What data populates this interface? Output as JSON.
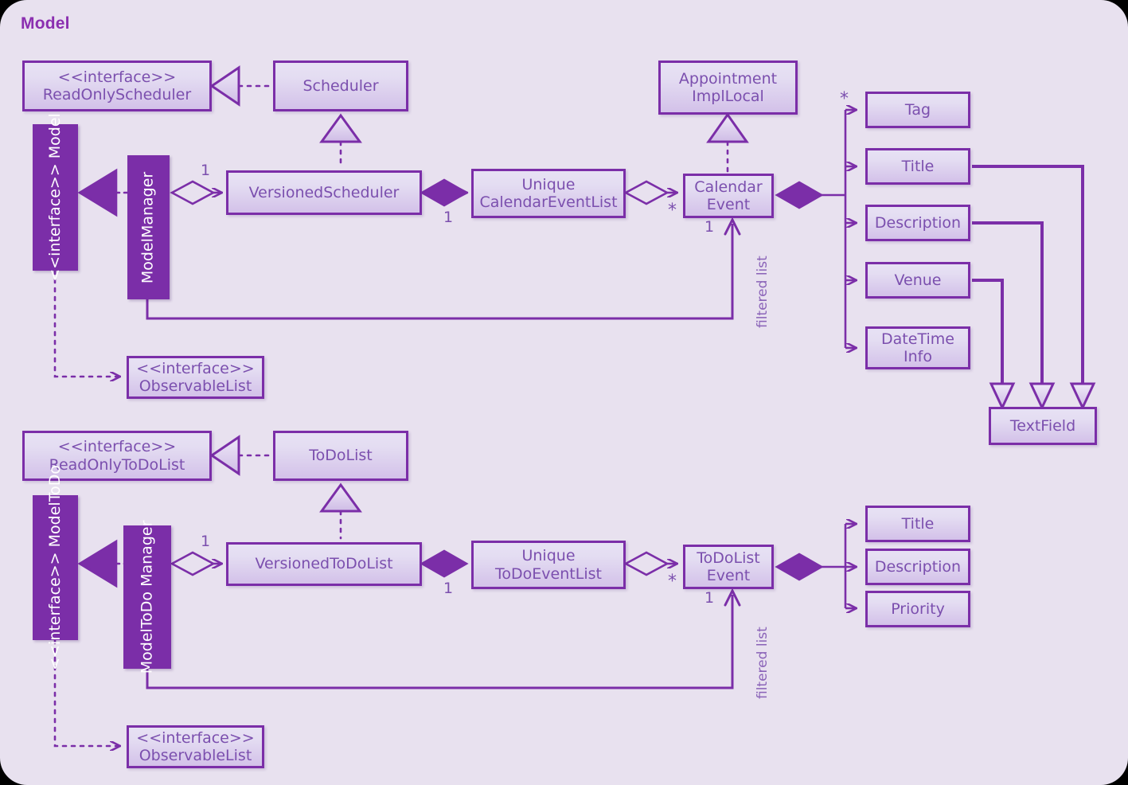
{
  "diagram": {
    "title": "Model",
    "type": "uml-class-diagram",
    "accent_color": "#7b2ea8",
    "text_color": "#7b4fae",
    "background_color": "#e8e1ef",
    "box_fill_top": "#e7e1f4",
    "box_fill_bottom": "#d3c1e9"
  },
  "classes": {
    "read_only_scheduler": {
      "stereotype": "<<interface>>",
      "name": "ReadOnlyScheduler"
    },
    "scheduler": {
      "name": "Scheduler"
    },
    "model": {
      "stereotype": "<<interface>>",
      "name": "Model"
    },
    "model_manager": {
      "name": "ModelManager"
    },
    "versioned_scheduler": {
      "name": "VersionedScheduler"
    },
    "unique_calendar_event_list": {
      "line1": "Unique",
      "line2": "CalendarEventList"
    },
    "appointment_impl_local": {
      "line1": "Appointment",
      "line2": "ImplLocal"
    },
    "calendar_event": {
      "line1": "Calendar",
      "line2": "Event"
    },
    "tag": {
      "name": "Tag"
    },
    "title_top": {
      "name": "Title"
    },
    "description_top": {
      "name": "Description"
    },
    "venue": {
      "name": "Venue"
    },
    "datetime_info": {
      "line1": "DateTime",
      "line2": "Info"
    },
    "text_field": {
      "name": "TextField"
    },
    "observable_list_top": {
      "stereotype": "<<interface>>",
      "name": "ObservableList"
    },
    "read_only_todo_list": {
      "stereotype": "<<interface>>",
      "name": "ReadOnlyToDoList"
    },
    "todo_list": {
      "name": "ToDoList"
    },
    "model_todo": {
      "stereotype": "<<interface>>",
      "name": "ModelToDo"
    },
    "model_todo_manager": {
      "line1": "ModelToDo",
      "line2": "Manager"
    },
    "versioned_todo_list": {
      "name": "VersionedToDoList"
    },
    "unique_todo_event_list": {
      "line1": "Unique",
      "line2": "ToDoEventList"
    },
    "todo_list_event": {
      "line1": "ToDoList",
      "line2": "Event"
    },
    "title_bottom": {
      "name": "Title"
    },
    "description_bottom": {
      "name": "Description"
    },
    "priority": {
      "name": "Priority"
    },
    "observable_list_bottom": {
      "stereotype": "<<interface>>",
      "name": "ObservableList"
    }
  },
  "edge_labels": {
    "mm_vs_one": "1",
    "vs_ucel_one": "1",
    "ucel_ce_star": "*",
    "ce_filtered_one": "1",
    "ce_filtered_text": "filtered list",
    "ce_tag_star": "*",
    "mtm_vtdl_one": "1",
    "vtdl_utel_one": "1",
    "utel_tle_star": "*",
    "tle_filtered_one": "1",
    "tle_filtered_text": "filtered list"
  }
}
